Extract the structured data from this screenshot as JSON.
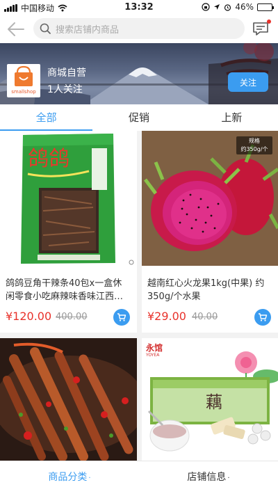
{
  "status_bar": {
    "carrier": "中国移动",
    "time": "13:32",
    "battery": "46%",
    "battery_level": 0.46
  },
  "header": {
    "search_placeholder": "搜索店铺内商品"
  },
  "shop": {
    "logo_text": "smallshop",
    "name": "商城自营",
    "followers": "1人关注",
    "follow_label": "关注"
  },
  "tabs": [
    {
      "label": "全部",
      "active": true
    },
    {
      "label": "促销",
      "active": false
    },
    {
      "label": "上新",
      "active": false
    }
  ],
  "products": [
    {
      "title": "鸽鸽豆角干辣条40包x一盒休闲零食小吃麻辣味香味江西…",
      "price": "¥120.00",
      "old_price": "400.00",
      "package_text": "鸽鸽"
    },
    {
      "title": "越南红心火龙果1kg(中果) 约350g/个水果",
      "price": "¥29.00",
      "old_price": "40.00",
      "spec_label": "规格",
      "spec_value": "约350g/个"
    },
    {
      "title": "",
      "price": "",
      "old_price": ""
    },
    {
      "title": "",
      "price": "",
      "old_price": "",
      "brand_text": "永馆",
      "brand_en": "YOYEA",
      "product_text": "藕"
    }
  ],
  "bottom_nav": {
    "category_label": "商品分类",
    "shop_info_label": "店铺信息"
  },
  "colors": {
    "accent": "#3b9cf0",
    "price": "#e8322b"
  }
}
